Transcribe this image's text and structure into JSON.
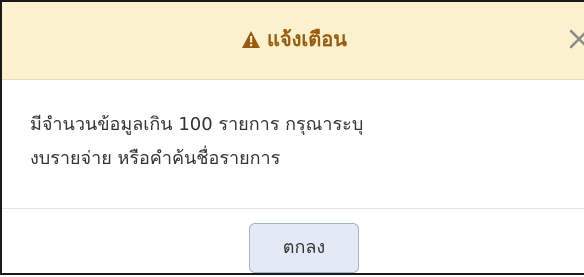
{
  "dialog": {
    "title": "แจ้งเตือน",
    "title_icon": "warning-triangle-icon",
    "close_icon": "close-x-icon",
    "close_label": "×",
    "message_line1": "มีจำนวนข้อมูลเกิน 100 รายการ กรุณาระบุ",
    "message_line2": "งบรายจ่าย หรือคำค้นชื่อรายการ",
    "ok_label": "ตกลง"
  },
  "colors": {
    "header_bg": "#fcf1cf",
    "title_text": "#9b5b0f",
    "button_bg": "#e4eaf5",
    "button_border": "#a7b2c5",
    "close_icon": "#8a8a8a"
  }
}
